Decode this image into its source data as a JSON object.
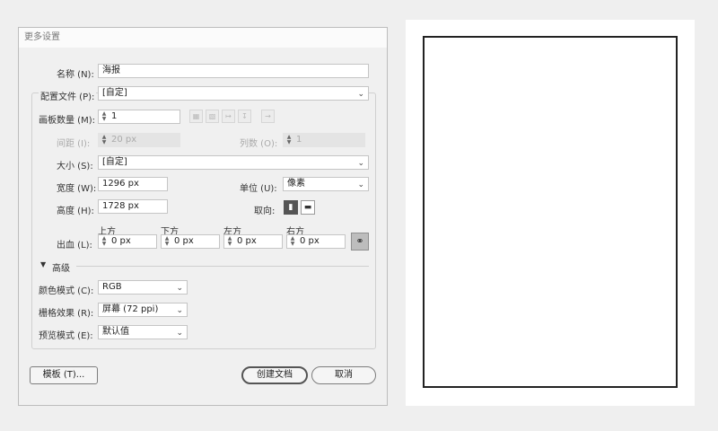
{
  "dialog": {
    "title": "更多设置",
    "name": {
      "label": "名称 (N):",
      "value": "海报"
    },
    "profile": {
      "label": "配置文件 (P):",
      "value": "[自定]"
    },
    "artboards": {
      "label": "画板数量 (M):",
      "value": "1"
    },
    "spacing": {
      "label": "间距 (I):",
      "value": "20 px"
    },
    "columns": {
      "label": "列数 (O):",
      "value": "1"
    },
    "size": {
      "label": "大小 (S):",
      "value": "[自定]"
    },
    "width": {
      "label": "宽度 (W):",
      "value": "1296 px"
    },
    "units": {
      "label": "单位 (U):",
      "value": "像素"
    },
    "height": {
      "label": "高度 (H):",
      "value": "1728 px"
    },
    "orientation": {
      "label": "取向:",
      "selected": "portrait"
    },
    "bleed": {
      "label": "出血 (L):",
      "top": {
        "label": "上方",
        "value": "0 px"
      },
      "bottom": {
        "label": "下方",
        "value": "0 px"
      },
      "left": {
        "label": "左方",
        "value": "0 px"
      },
      "right": {
        "label": "右方",
        "value": "0 px"
      },
      "linked": true
    },
    "advanced": {
      "label": "高级",
      "expanded": true
    },
    "color_mode": {
      "label": "颜色模式 (C):",
      "value": "RGB"
    },
    "raster": {
      "label": "栅格效果 (R):",
      "value": "屏幕 (72 ppi)"
    },
    "preview_mode": {
      "label": "预览模式 (E):",
      "value": "默认值"
    },
    "buttons": {
      "templates": "模板 (T)...",
      "create": "创建文档",
      "cancel": "取消"
    }
  },
  "icons": {
    "chevron": "chevron-down-icon",
    "spinner": "stepper-icon",
    "link": "chain-link-icon",
    "collapse": "triangle-down-icon"
  },
  "colors": {
    "accent": "#555555",
    "background": "#f0f0f0",
    "artboard_border": "#222222"
  }
}
